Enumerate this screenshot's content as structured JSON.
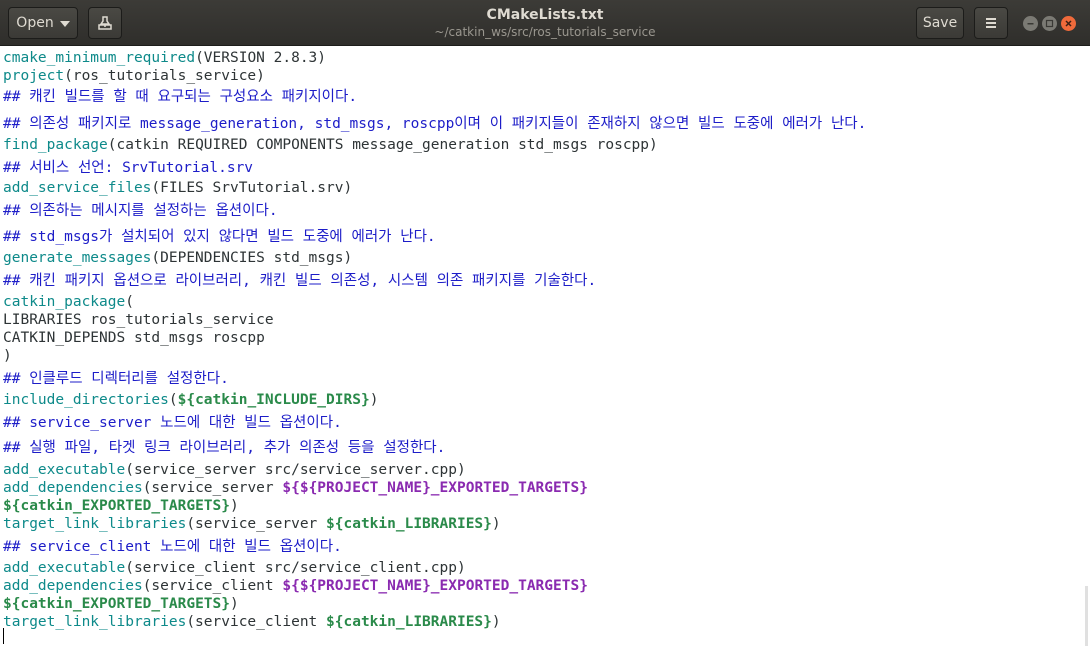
{
  "header": {
    "open_label": "Open",
    "title": "CMakeLists.txt",
    "subtitle": "~/catkin_ws/src/ros_tutorials_service",
    "save_label": "Save"
  },
  "icons": {
    "pin": "pin-icon",
    "caret": "chevron-down-icon",
    "menu": "hamburger-menu-icon",
    "minimize": "minimize-icon",
    "maximize": "maximize-icon",
    "close": "close-icon"
  },
  "colors": {
    "function": "#0e8a8a",
    "comment": "#1d1dc8",
    "variable": "#2a8a4a",
    "project_variable": "#8a2ab0",
    "close_button": "#ef6a3b"
  },
  "editor": {
    "lines": [
      [
        [
          "fn",
          "cmake_minimum_required"
        ],
        [
          "t",
          "(VERSION 2.8.3)"
        ]
      ],
      [
        [
          "fn",
          "project"
        ],
        [
          "t",
          "(ros_tutorials_service)"
        ]
      ],
      [
        [
          "cm",
          "## 캐킨 빌드를 할 때 요구되는 구성요소 패키지이다."
        ]
      ],
      [
        [
          "cm",
          "## 의존성 패키지로 message_generation, std_msgs, roscpp이며 이 패키지들이 존재하지 않으면 빌드 도중에 에러가 난다."
        ]
      ],
      [
        [
          "fn",
          "find_package"
        ],
        [
          "t",
          "(catkin REQUIRED COMPONENTS message_generation std_msgs roscpp)"
        ]
      ],
      [
        [
          "cm",
          "## 서비스 선언: SrvTutorial.srv"
        ]
      ],
      [
        [
          "fn",
          "add_service_files"
        ],
        [
          "t",
          "(FILES SrvTutorial.srv)"
        ]
      ],
      [
        [
          "cm",
          "## 의존하는 메시지를 설정하는 옵션이다."
        ]
      ],
      [
        [
          "cm",
          "## std_msgs가 설치되어 있지 않다면 빌드 도중에 에러가 난다."
        ]
      ],
      [
        [
          "fn",
          "generate_messages"
        ],
        [
          "t",
          "(DEPENDENCIES std_msgs)"
        ]
      ],
      [
        [
          "cm",
          "## 캐킨 패키지 옵션으로 라이브러리, 캐킨 빌드 의존성, 시스템 의존 패키지를 기술한다."
        ]
      ],
      [
        [
          "fn",
          "catkin_package"
        ],
        [
          "t",
          "("
        ]
      ],
      [
        [
          "t",
          "LIBRARIES ros_tutorials_service"
        ]
      ],
      [
        [
          "t",
          "CATKIN_DEPENDS std_msgs roscpp"
        ]
      ],
      [
        [
          "t",
          ")"
        ]
      ],
      [
        [
          "cm",
          "## 인클루드 디렉터리를 설정한다."
        ]
      ],
      [
        [
          "fn",
          "include_directories"
        ],
        [
          "t",
          "("
        ],
        [
          "var",
          "${"
        ],
        [
          "var",
          "catkin_INCLUDE_DIRS"
        ],
        [
          "var",
          "}"
        ],
        [
          "t",
          ")"
        ]
      ],
      [
        [
          "cm",
          "## service_server 노드에 대한 빌드 옵션이다."
        ]
      ],
      [
        [
          "cm",
          "## 실행 파일, 타겟 링크 라이브러리, 추가 의존성 등을 설정한다."
        ]
      ],
      [
        [
          "fn",
          "add_executable"
        ],
        [
          "t",
          "(service_server src/service_server.cpp)"
        ]
      ],
      [
        [
          "fn",
          "add_dependencies"
        ],
        [
          "t",
          "(service_server "
        ],
        [
          "pvar",
          "${${"
        ],
        [
          "pvar",
          "PROJECT_NAME"
        ],
        [
          "pvar",
          "}_EXPORTED_TARGETS}"
        ]
      ],
      [
        [
          "var",
          "${"
        ],
        [
          "var",
          "catkin_EXPORTED_TARGETS"
        ],
        [
          "var",
          "}"
        ],
        [
          "t",
          ")"
        ]
      ],
      [
        [
          "fn",
          "target_link_libraries"
        ],
        [
          "t",
          "(service_server "
        ],
        [
          "var",
          "${"
        ],
        [
          "var",
          "catkin_LIBRARIES"
        ],
        [
          "var",
          "}"
        ],
        [
          "t",
          ")"
        ]
      ],
      [
        [
          "cm",
          "## service_client 노드에 대한 빌드 옵션이다."
        ]
      ],
      [
        [
          "fn",
          "add_executable"
        ],
        [
          "t",
          "(service_client src/service_client.cpp)"
        ]
      ],
      [
        [
          "fn",
          "add_dependencies"
        ],
        [
          "t",
          "(service_client "
        ],
        [
          "pvar",
          "${${"
        ],
        [
          "pvar",
          "PROJECT_NAME"
        ],
        [
          "pvar",
          "}_EXPORTED_TARGETS}"
        ]
      ],
      [
        [
          "var",
          "${"
        ],
        [
          "var",
          "catkin_EXPORTED_TARGETS"
        ],
        [
          "var",
          "}"
        ],
        [
          "t",
          ")"
        ]
      ],
      [
        [
          "fn",
          "target_link_libraries"
        ],
        [
          "t",
          "(service_client "
        ],
        [
          "var",
          "${"
        ],
        [
          "var",
          "catkin_LIBRARIES"
        ],
        [
          "var",
          "}"
        ],
        [
          "t",
          ")"
        ]
      ]
    ]
  }
}
